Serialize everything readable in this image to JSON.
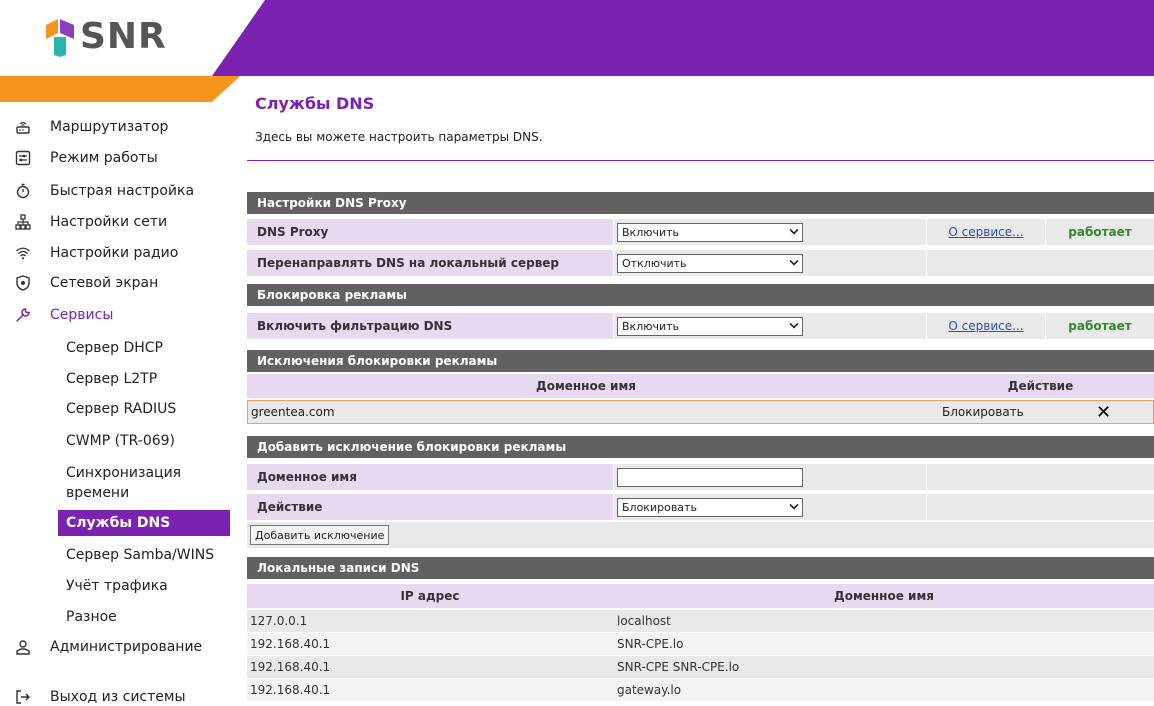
{
  "brand": {
    "logo_text": "SNR",
    "purple": "#7b22b0",
    "orange": "#f7941d",
    "green": "#2e8b2e"
  },
  "sidebar": {
    "items": [
      {
        "label": "Маршрутизатор",
        "icon": "router-icon"
      },
      {
        "label": "Режим работы",
        "icon": "mode-icon"
      },
      {
        "label": "Быстрая настройка",
        "icon": "stopwatch-icon"
      },
      {
        "label": "Настройки сети",
        "icon": "network-icon"
      },
      {
        "label": "Настройки радио",
        "icon": "wifi-icon"
      },
      {
        "label": "Сетевой экран",
        "icon": "shield-icon"
      },
      {
        "label": "Сервисы",
        "icon": "wrench-icon"
      },
      {
        "label": "Администрирование",
        "icon": "user-icon"
      },
      {
        "label": "Выход из системы",
        "icon": "logout-icon"
      }
    ],
    "sub_items": [
      "Сервер DHCP",
      "Сервер L2TP",
      "Сервер RADIUS",
      "CWMP (TR-069)",
      "Синхронизация",
      "времени",
      "Службы DNS",
      "Сервер Samba/WINS",
      "Учёт трафика",
      "Разное"
    ]
  },
  "page": {
    "title": "Службы DNS",
    "description": "Здесь вы можете настроить параметры DNS."
  },
  "proxy": {
    "header": "Настройки DNS Proxy",
    "dns_proxy_label": "DNS Proxy",
    "dns_proxy_value": "Включить",
    "about_label": "О сервисе...",
    "status": "работает",
    "redirect_label": "Перенаправлять DNS на локальный сервер",
    "redirect_value": "Отключить"
  },
  "adblock": {
    "header": "Блокировка рекламы",
    "filter_label": "Включить фильтрацию DNS",
    "filter_value": "Включить",
    "about_label": "О сервисе...",
    "status": "работает"
  },
  "exceptions": {
    "header": "Исключения блокировки рекламы",
    "col_domain": "Доменное имя",
    "col_action": "Действие",
    "rows": [
      {
        "domain": "greentea.com",
        "action": "Блокировать",
        "delete": "✕"
      }
    ]
  },
  "add_exception": {
    "header": "Добавить исключение блокировки рекламы",
    "domain_label": "Доменное имя",
    "domain_value": "",
    "action_label": "Действие",
    "action_value": "Блокировать",
    "button": "Добавить исключение"
  },
  "local_records": {
    "header": "Локальные записи DNS",
    "col_ip": "IP адрес",
    "col_domain": "Доменное имя",
    "rows": [
      {
        "ip": "127.0.0.1",
        "domain": "localhost"
      },
      {
        "ip": "192.168.40.1",
        "domain": "SNR-CPE.lo"
      },
      {
        "ip": "192.168.40.1",
        "domain": "SNR-CPE SNR-CPE.lo"
      },
      {
        "ip": "192.168.40.1",
        "domain": "gateway.lo"
      }
    ]
  }
}
